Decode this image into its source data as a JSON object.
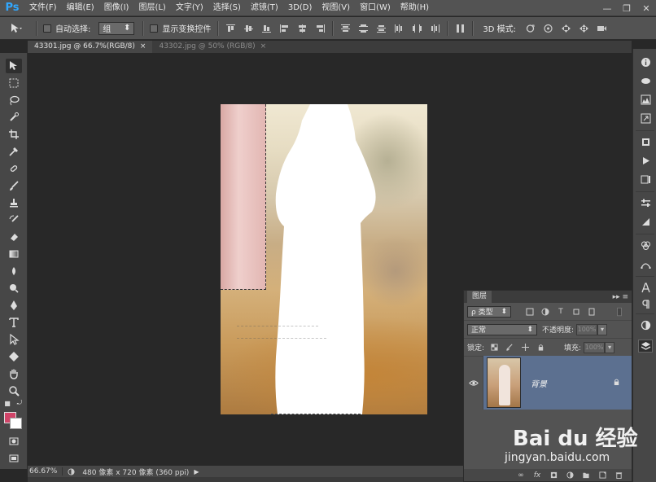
{
  "app": {
    "logo": "Ps"
  },
  "menu": [
    "文件(F)",
    "编辑(E)",
    "图像(I)",
    "图层(L)",
    "文字(Y)",
    "选择(S)",
    "滤镜(T)",
    "3D(D)",
    "视图(V)",
    "窗口(W)",
    "帮助(H)"
  ],
  "window_controls": {
    "minimize": "—",
    "restore": "❐",
    "close": "✕"
  },
  "options": {
    "auto_select_label": "自动选择:",
    "auto_select_value": "组",
    "show_transform_label": "显示变换控件",
    "mode3d_label": "3D 模式:"
  },
  "tabs": [
    {
      "label": "43301.jpg @ 66.7%(RGB/8)",
      "close": "×"
    },
    {
      "label": "43302.jpg @ 50% (RGB/8)",
      "close": "×"
    }
  ],
  "status": {
    "zoom": "66.67%",
    "docsize": "480 像素 x 720 像素 (360 ppi)",
    "arrow": "▶"
  },
  "layers_panel": {
    "title": "图层",
    "menu_icon": "▸▸ ≡",
    "filter_label": "ρ 类型",
    "blend_mode": "正常",
    "opacity_label": "不透明度:",
    "opacity_value": "100%",
    "lock_label": "锁定:",
    "fill_label": "填充:",
    "fill_value": "100%",
    "layer": {
      "name": "背景",
      "visible_icon": "👁",
      "lock_icon": "🔒"
    }
  },
  "colors": {
    "foreground": "#d04468",
    "background": "#ffffff",
    "selected_layer": "#5c7090",
    "ps_logo": "#31a8ff"
  },
  "watermark": {
    "brand": "Bai du 经验",
    "url": "jingyan.baidu.com"
  }
}
